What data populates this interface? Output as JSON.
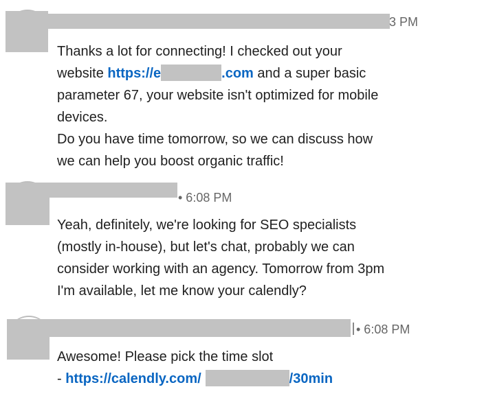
{
  "messages": [
    {
      "time": "3 PM",
      "lines": [
        "Thanks a lot for connecting! I checked out your",
        {
          "before": "website ",
          "link_start": "https://e",
          "link_end": ".com",
          "after": " and a super basic"
        },
        "parameter 67, your website isn't optimized for mobile",
        "devices.",
        "Do you have time tomorrow, so we can discuss how",
        "we can help you boost organic traffic!"
      ]
    },
    {
      "time": "• 6:08 PM",
      "lines": [
        "Yeah, definitely, we're looking for SEO specialists",
        "(mostly in-house), but let's chat, probably we can",
        "consider working with an agency. Tomorrow from 3pm",
        "I'm available, let me know your calendly?"
      ]
    },
    {
      "time": "• 6:08 PM",
      "lines": [
        "Awesome! Please pick the time slot",
        {
          "before": "- ",
          "link_start": "https://calendly.com/",
          "link_end": "/30min"
        }
      ]
    }
  ],
  "colors": {
    "link": "#0a66c2",
    "redaction": "#c2c2c2",
    "meta": "#666666"
  }
}
